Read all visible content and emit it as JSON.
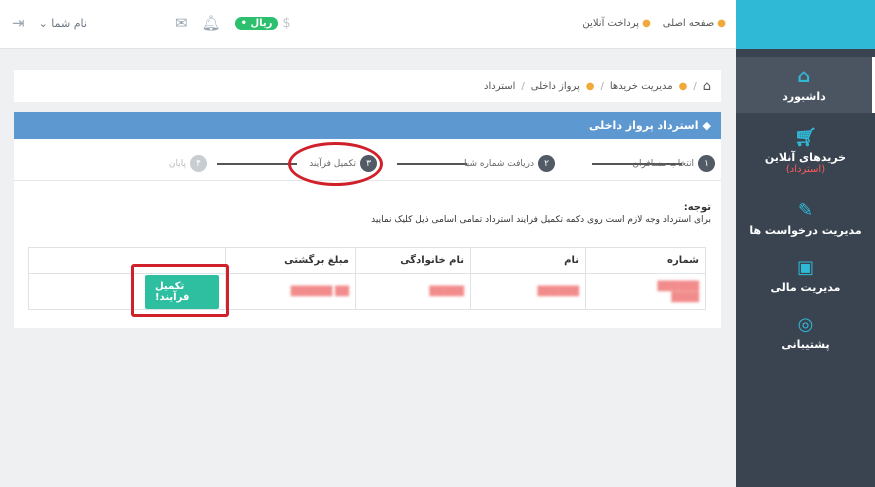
{
  "sidebar": {
    "items": [
      {
        "label": "داشبورد",
        "icon": "home-icon"
      },
      {
        "label": "خریدهای آنلاین",
        "sub": "(استرداد)",
        "icon": "cart-icon"
      },
      {
        "label": "مدیریت درخواست ها",
        "icon": "edit-icon"
      },
      {
        "label": "مدیریت مالی",
        "icon": "money-icon"
      },
      {
        "label": "پشتیبانی",
        "icon": "support-icon"
      }
    ]
  },
  "topbar": {
    "nav": [
      "صفحه اصلی",
      "پرداخت آنلاین"
    ],
    "user": "نام شما",
    "wallet": "• ریال"
  },
  "breadcrumb": [
    "مدیریت خریدها",
    "پرواز داخلی",
    "استرداد"
  ],
  "panel": {
    "title": "استرداد پرواز داخلی",
    "steps": [
      {
        "num": "۱",
        "label": "انتخاب مسافران"
      },
      {
        "num": "۲",
        "label": "دریافت شماره شبا"
      },
      {
        "num": "۳",
        "label": "تکمیل فرآیند"
      },
      {
        "num": "۴",
        "label": "پایان"
      }
    ],
    "note_title": "توجه:",
    "note_text": "برای استرداد وجه لازم است روی دکمه تکمیل فرایند استرداد تمامی اسامی ذیل کلیک نمایید"
  },
  "table": {
    "headers": [
      "شماره",
      "نام",
      "نام خانوادگی",
      "مبلغ برگشتی",
      ""
    ],
    "button_label": "تکمیل فرآیند!"
  }
}
